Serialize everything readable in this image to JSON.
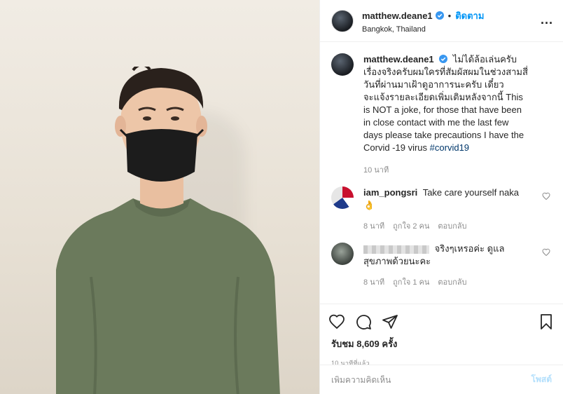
{
  "header": {
    "username": "matthew.deane1",
    "separator": "•",
    "follow_label": "ติดตาม",
    "location": "Bangkok, Thailand",
    "more_label": "..."
  },
  "caption": {
    "username": "matthew.deane1",
    "text": "ไม่ได้ล้อเล่นครับ เรื่องจริงครับผมใครที่สัมผัสผมในช่วงสามสี่วันที่ผ่านมาเฝ้าดูอาการนะครับ เดี๋ยวจะแจ้งรายละเอียดเพิ่มเติมหลังจากนี้ This is NOT a joke, for those that have been in close contact with me the last few days please take precautions I have the Corvid -19 virus",
    "hashtag": "#corvid19",
    "time": "10 นาที"
  },
  "comments": [
    {
      "username": "iam_pongsri",
      "text": "Take care yourself naka👌",
      "time": "8 นาที",
      "likes": "ถูกใจ 2 คน",
      "reply": "ตอบกลับ"
    },
    {
      "username": "",
      "text": "จริงๆเหรอค่ะ ดูแลสุขภาพด้วยนะคะ",
      "time": "8 นาที",
      "likes": "ถูกใจ 1 คน",
      "reply": "ตอบกลับ"
    }
  ],
  "stats": {
    "likes": "รับชม 8,609 ครั้ง",
    "posted": "10 นาทีที่แล้ว"
  },
  "add_comment": {
    "placeholder": "เพิ่มความคิดเห็น",
    "post_label": "โพสต์"
  },
  "colors": {
    "accent": "#0095f6",
    "verified": "#3897f0",
    "muted": "#8e8e8e",
    "shirt": "#6b7a5c",
    "mask": "#1c1c1c"
  }
}
